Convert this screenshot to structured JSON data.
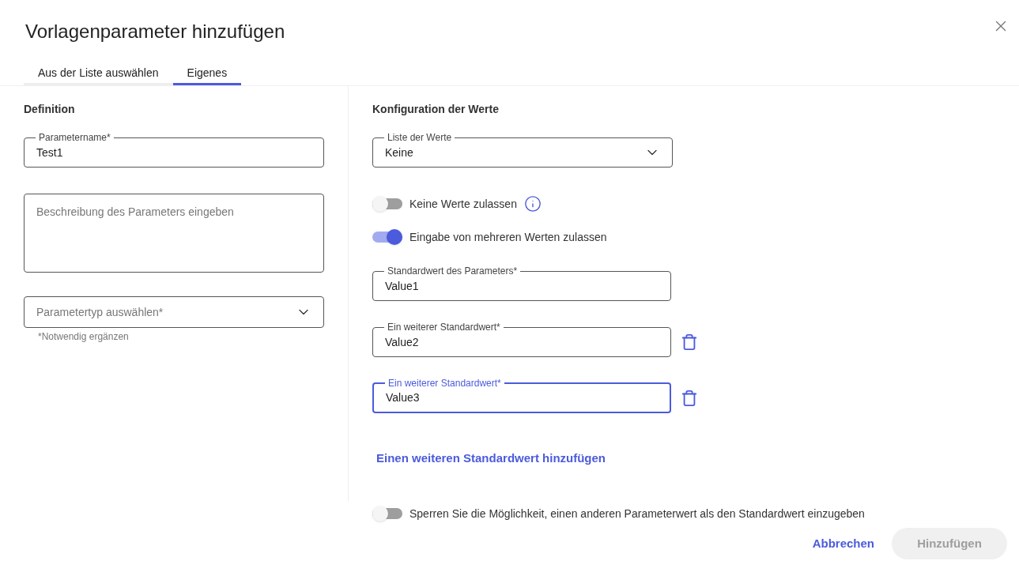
{
  "dialog": {
    "title": "Vorlagenparameter hinzufügen"
  },
  "tabs": [
    {
      "label": "Aus der Liste auswählen",
      "selected": false
    },
    {
      "label": "Eigenes",
      "selected": true
    }
  ],
  "definition": {
    "heading": "Definition",
    "name_field": {
      "label": "Parametername*",
      "value": "Test1"
    },
    "description": {
      "placeholder": "Beschreibung des Parameters eingeben"
    },
    "type_select": {
      "placeholder": "Parametertyp auswählen*",
      "helper": "*Notwendig ergänzen"
    }
  },
  "values_config": {
    "heading": "Konfiguration der Werte",
    "list_select": {
      "label": "Liste der Werte",
      "value": "Keine"
    },
    "toggles": [
      {
        "label": "Keine Werte zulassen",
        "on": false,
        "info": true
      },
      {
        "label": "Eingabe von mehreren Werten zulassen",
        "on": true,
        "info": false
      }
    ],
    "default_values": [
      {
        "label": "Standardwert des Parameters*",
        "value": "Value1",
        "focused": false,
        "removable": false
      },
      {
        "label": "Ein weiterer Standardwert*",
        "value": "Value2",
        "focused": false,
        "removable": true
      },
      {
        "label": "Ein weiterer Standardwert*",
        "value": "Value3",
        "focused": true,
        "removable": true
      }
    ],
    "add_link": "Einen weiteren Standardwert hinzufügen"
  },
  "lock_toggle": {
    "label": "Sperren Sie die Möglichkeit, einen anderen Parameterwert als den Standardwert einzugeben",
    "on": false
  },
  "buttons": [
    {
      "label": "Abbrechen",
      "kind": "text",
      "disabled": false
    },
    {
      "label": "Hinzufügen",
      "kind": "filled",
      "disabled": true
    }
  ]
}
